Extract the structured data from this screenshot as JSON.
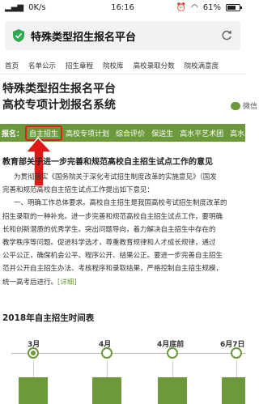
{
  "status_bar": {
    "carrier_icon": "sim-4g",
    "network": "0K/s",
    "time": "16:16",
    "battery_text": "61%"
  },
  "url_bar": {
    "title": "特殊类型招生报名平台"
  },
  "nav": {
    "items": [
      "首页",
      "名单公示",
      "招生章程",
      "院校库",
      "高校录取分数",
      "院校满意度"
    ]
  },
  "site": {
    "title_line1": "特殊类型招生报名平台",
    "title_line2": "高校专项计划报名系统",
    "wechat": "微信"
  },
  "categories": {
    "label": "报名：",
    "items": [
      "自主招生",
      "高校专项计划",
      "综合评价",
      "保送生",
      "高水平艺术团",
      "高水平运动队"
    ]
  },
  "article": {
    "title": "教育部关于进一步完善和规范高校自主招生试点工作的意见",
    "lines": [
      "为贯彻落实《国务院关于深化考试招生制度改革的实施意见》（国发",
      "完善和规范高校自主招生试点工作提出如下意见：",
      "一、明确工作总体要求。高校自主招生是我国高校考试招生制度改革的",
      "招生录取的一种补充。进一步完善和规范高校自主招生试点工作，要明确",
      "长和创新潜质的优秀学生。突出问题导向，着力解决自主招生中存在的",
      "教学秩序等问题。促进科学选才，尊重教育规律和人才成长规律，通过",
      "公平公正，确保机会公平、程序公开、结果公正。要进一步完善自主招生",
      "范并公开自主招生办法、考核程序和录取结果，严格控制自主招生规模，",
      "统一高考后进行。"
    ],
    "detail_link": "[详细]"
  },
  "timeline": {
    "title": "2018年自主招生时间表",
    "labels": [
      "3月",
      "4月",
      "4月底前",
      "6月7日"
    ]
  }
}
